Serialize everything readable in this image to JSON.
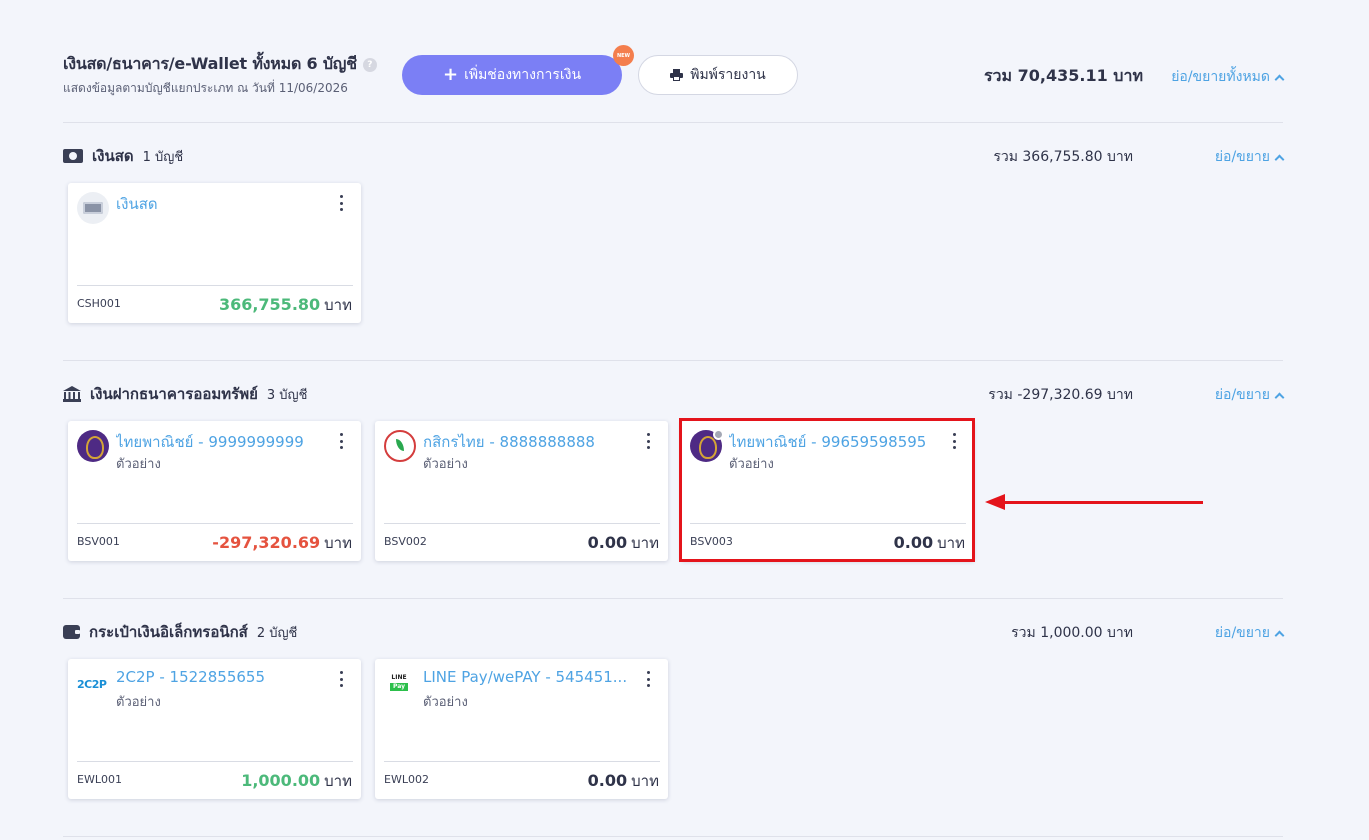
{
  "header": {
    "title": "เงินสด/ธนาคาร/e-Wallet ทั้งหมด 6 บัญชี",
    "subtitle": "แสดงข้อมูลตามบัญชีแยกประเภท ณ วันที่ 11/06/2026",
    "add_button_label": "เพิ่มช่องทางการเงิน",
    "new_badge": "NEW",
    "print_button_label": "พิมพ์รายงาน",
    "grand_total": "รวม 70,435.11 บาท",
    "collapse_all_label": "ย่อ/ขยายทั้งหมด"
  },
  "sections": [
    {
      "title": "เงินสด",
      "count": "1 บัญชี",
      "icon": "cash-icon",
      "total": "รวม 366,755.80 บาท",
      "toggle": "ย่อ/ขยาย",
      "cards": [
        {
          "name": "เงินสด",
          "desc": "",
          "code": "CSH001",
          "amount": "366,755.80",
          "unit": "บาท",
          "logo": "cash-logo"
        }
      ]
    },
    {
      "title": "เงินฝากธนาคารออมทรัพย์",
      "count": "3 บัญชี",
      "icon": "bank-icon",
      "total": "รวม -297,320.69 บาท",
      "toggle": "ย่อ/ขยาย",
      "cards": [
        {
          "name": "ไทยพาณิชย์ - 9999999999",
          "desc": "ตัวอย่าง",
          "code": "BSV001",
          "amount": "-297,320.69",
          "unit": "บาท",
          "logo": "scb-logo"
        },
        {
          "name": "กสิกรไทย - 8888888888",
          "desc": "ตัวอย่าง",
          "code": "BSV002",
          "amount": "0.00",
          "unit": "บาท",
          "logo": "kbank-logo"
        },
        {
          "name": "ไทยพาณิชย์ - 99659598595",
          "desc": "ตัวอย่าง",
          "code": "BSV003",
          "amount": "0.00",
          "unit": "บาท",
          "logo": "scb-logo"
        }
      ]
    },
    {
      "title": "กระเป๋าเงินอิเล็กทรอนิกส์",
      "count": "2 บัญชี",
      "icon": "wallet-icon",
      "total": "รวม 1,000.00 บาท",
      "toggle": "ย่อ/ขยาย",
      "cards": [
        {
          "name": "2C2P - 1522855655",
          "desc": "ตัวอย่าง",
          "code": "EWL001",
          "amount": "1,000.00",
          "unit": "บาท",
          "logo": "2c2p-logo",
          "logo_text": "2C2P"
        },
        {
          "name": "LINE Pay/wePAY - 545451...",
          "desc": "ตัวอย่าง",
          "code": "EWL002",
          "amount": "0.00",
          "unit": "บาท",
          "logo": "linepay-logo",
          "logo_text": "LINE",
          "logo_text2": "Pay"
        }
      ]
    }
  ],
  "colors": {
    "accent": "#7b7ff5",
    "link": "#4ea3e3",
    "positive": "#4cb97a",
    "negative": "#e5533f",
    "highlight": "#e4141b"
  }
}
